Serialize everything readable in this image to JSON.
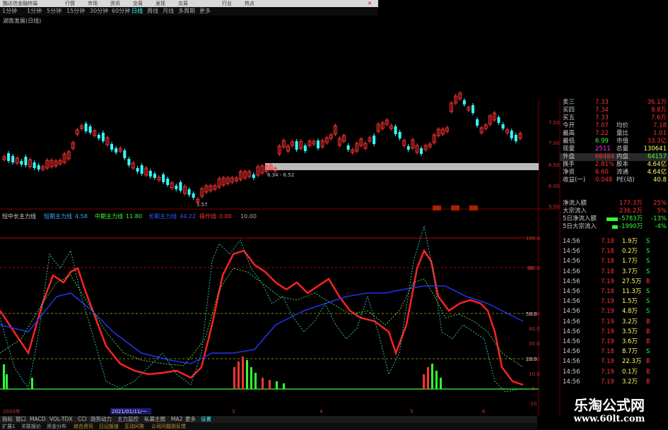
{
  "window": {
    "title": "酷达信金融终端"
  },
  "menu": [
    "行情",
    "市场",
    "资讯",
    "交易",
    "发现",
    "交易",
    "行业",
    "热点"
  ],
  "timeframes": [
    "1分钟",
    "1分钟",
    "5分钟",
    "15分钟",
    "30分钟",
    "60分钟",
    "日线",
    "周线",
    "月线",
    "多周期",
    "更多"
  ],
  "stock_label": "湖南发展(日线)",
  "price_axis": [
    "7.50",
    "7.00",
    "6.50",
    "6.00",
    "5.50"
  ],
  "price_range_label": "6.34 - 6.52",
  "low_label": "5.57",
  "indicator": {
    "name": "短中长主力线",
    "items": [
      {
        "label": "短期主力线",
        "value": "4.58",
        "color": "#33aaff"
      },
      {
        "label": "中期主力线",
        "value": "11.80",
        "color": "#33ff33"
      },
      {
        "label": "长期主力线",
        "value": "44.22",
        "color": "#3355ff"
      },
      {
        "label": "操作线",
        "value": "0.00",
        "color": "#ff3333"
      },
      {
        "label": "",
        "value": "10.00",
        "color": "#aaaaaa"
      }
    ]
  },
  "ind_axis": [
    "100.0",
    "80.0",
    "50.0",
    "40.0",
    "30.0",
    "20.0",
    "10.0",
    "0",
    "-10"
  ],
  "ind_mid_labels": [
    "80",
    "50.0",
    "20.0"
  ],
  "date_axis": [
    "2020年",
    "2021/01/11/一",
    "3",
    "4",
    "5",
    "6"
  ],
  "quote": [
    {
      "l": "卖三",
      "v1": "7.33",
      "l2": "",
      "v2": "36.1万"
    },
    {
      "l": "买四",
      "v1": "7.34",
      "l2": "",
      "v2": "9.8万"
    },
    {
      "l": "买五",
      "v1": "7.33",
      "l2": "",
      "v2": "7.6万"
    },
    {
      "l": "今开",
      "v1": "7.07",
      "l2": "均价",
      "v2": "7.18"
    },
    {
      "l": "最高",
      "v1": "7.22",
      "l2": "量比",
      "v2": "1.01"
    },
    {
      "l": "最低",
      "v1": "6.99",
      "l2": "市值",
      "v2": "33.3亿"
    },
    {
      "l": "现量",
      "v1": "2511",
      "l2": "总量",
      "v2": "130641"
    },
    {
      "l": "外盘",
      "v1": "66484",
      "l2": "内盘",
      "v2": "64157"
    },
    {
      "l": "换手",
      "v1": "2.81%",
      "l2": "股本",
      "v2": "4.64亿"
    },
    {
      "l": "净资",
      "v1": "6.60",
      "l2": "流通",
      "v2": "4.64亿"
    },
    {
      "l": "收益(一)",
      "v1": "0.048",
      "l2": "PE(动)",
      "v2": "40.8"
    }
  ],
  "flows": [
    {
      "l": "净流入额",
      "v": "177.3万",
      "p": "25%"
    },
    {
      "l": "大宗流入",
      "v": "236.2万",
      "p": "5%"
    },
    {
      "l": "5日净流入额",
      "v": "-5783万",
      "p": "-13%"
    },
    {
      "l": "5日大宗流入",
      "v": "-1990万",
      "p": "-4%"
    }
  ],
  "ticks": [
    [
      "14:56",
      "7.18",
      "1.9万",
      "S"
    ],
    [
      "14:56",
      "7.18",
      "0.2万",
      "S"
    ],
    [
      "14:56",
      "7.18",
      "1.7万",
      "S"
    ],
    [
      "14:56",
      "7.18",
      "3.7万",
      "S"
    ],
    [
      "14:56",
      "7.19",
      "27.5万",
      "B"
    ],
    [
      "14:56",
      "7.18",
      "11.3万",
      "S"
    ],
    [
      "14:56",
      "7.19",
      "1.5万",
      "S"
    ],
    [
      "14:56",
      "7.19",
      "4.8万",
      "S"
    ],
    [
      "14:56",
      "7.19",
      "3.2万",
      "B"
    ],
    [
      "14:56",
      "7.19",
      "3.5万",
      "B"
    ],
    [
      "14:56",
      "7.19",
      "3.6万",
      "B"
    ],
    [
      "14:56",
      "7.18",
      "8.7万",
      "S"
    ],
    [
      "14:56",
      "7.19",
      "22.3万",
      "B"
    ],
    [
      "14:56",
      "7.19",
      "0.1万",
      "B"
    ],
    [
      "14:56",
      "7.19",
      "3.2万",
      "B"
    ]
  ],
  "bottom_tabs": [
    "指标",
    "窗口",
    "MACD",
    "VOL-TDX",
    "CCI",
    "趋势动力",
    "主力监控",
    "私募主图",
    "MA2",
    "更多",
    "设置"
  ],
  "status": [
    "扩展1",
    "关联报价",
    "资金分布",
    "综合资讯",
    "日记报道",
    "互动问答",
    "公司问题则反馈"
  ],
  "watermark": {
    "cn": "乐淘公式网",
    "url": "www.60lt.com"
  },
  "colors": {
    "up": "#ff3333",
    "down": "#33ffff",
    "accent": "#ffff33"
  }
}
